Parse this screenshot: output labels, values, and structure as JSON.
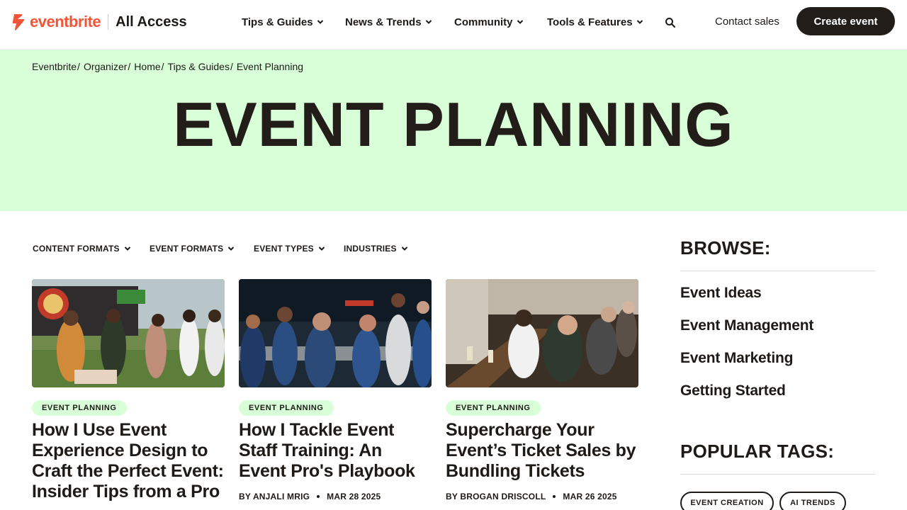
{
  "header": {
    "brand": "eventbrite",
    "sub_brand": "All Access",
    "nav": [
      {
        "label": "Tips & Guides"
      },
      {
        "label": "News & Trends"
      },
      {
        "label": "Community"
      },
      {
        "label": "Tools & Features"
      }
    ],
    "contact_label": "Contact sales",
    "create_label": "Create event"
  },
  "breadcrumb": [
    "Eventbrite",
    "Organizer",
    "Home",
    "Tips & Guides",
    "Event Planning"
  ],
  "hero": {
    "title": "EVENT PLANNING"
  },
  "filters": [
    {
      "label": "CONTENT FORMATS"
    },
    {
      "label": "EVENT FORMATS"
    },
    {
      "label": "EVENT TYPES"
    },
    {
      "label": "INDUSTRIES"
    }
  ],
  "cards": [
    {
      "tag": "EVENT PLANNING",
      "title": "How I Use Event Experience Design to Craft the Perfect Event: Insider Tips from a Pro",
      "author": "",
      "date": ""
    },
    {
      "tag": "EVENT PLANNING",
      "title": "How I Tackle Event Staff Training: An Event Pro's Playbook",
      "author": "BY ANJALI MRIG",
      "date": "MAR 28 2025"
    },
    {
      "tag": "EVENT PLANNING",
      "title": "Supercharge Your Event’s Ticket Sales by Bundling Tickets",
      "author": "BY BROGAN DRISCOLL",
      "date": "MAR 26 2025"
    }
  ],
  "sidebar": {
    "browse_heading": "BROWSE:",
    "browse_links": [
      "Event Ideas",
      "Event Management",
      "Event Marketing",
      "Getting Started"
    ],
    "tags_heading": "POPULAR TAGS:",
    "tags": [
      "EVENT CREATION",
      "AI TRENDS"
    ]
  },
  "colors": {
    "brand": "#f05537",
    "hero_bg": "#d9ffd9",
    "dark": "#221d19"
  }
}
